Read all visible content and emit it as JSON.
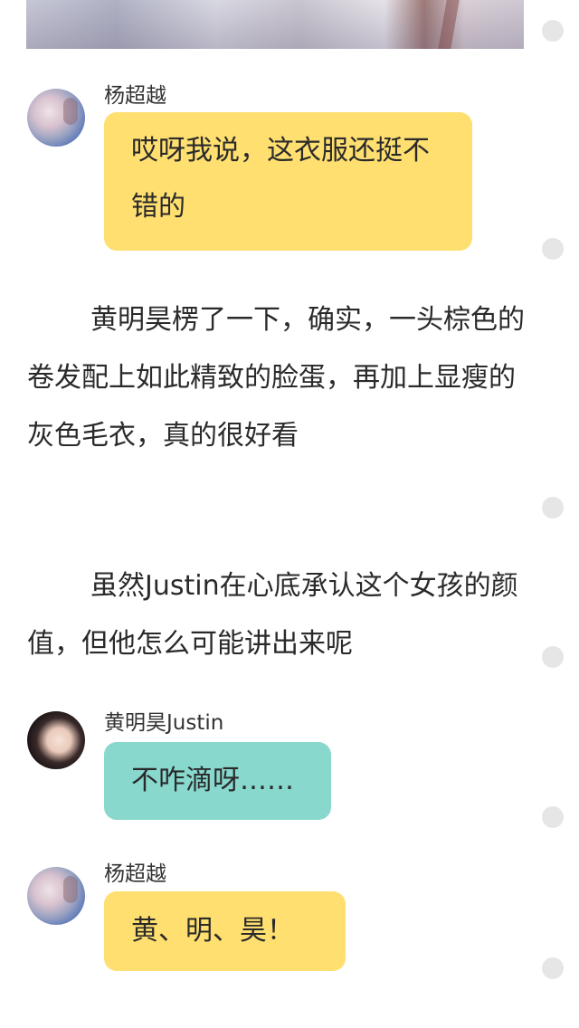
{
  "top_image": {
    "icon": "photo-strip"
  },
  "messages": [
    {
      "sender": "杨超越",
      "avatar_icon": "yang-avatar",
      "text": "哎呀我说，这衣服还挺不错的",
      "bubble_color": "#fedf70"
    },
    {
      "sender": "黄明昊Justin",
      "avatar_icon": "huang-avatar",
      "text": "不咋滴呀……",
      "bubble_color": "#88d8ce"
    },
    {
      "sender": "杨超越",
      "avatar_icon": "yang-avatar",
      "text": "黄、明、昊！",
      "bubble_color": "#fedf70"
    }
  ],
  "paragraphs": [
    "黄明昊楞了一下，确实，一头棕色的卷发配上如此精致的脸蛋，再加上显瘦的灰色毛衣，真的很好看",
    "虽然Justin在心底承认这个女孩的颜值，但他怎么可能讲出来呢"
  ],
  "colors": {
    "yellow_bubble": "#fedf70",
    "teal_bubble": "#88d8ce",
    "gutter_dot": "#e6e6e6"
  }
}
